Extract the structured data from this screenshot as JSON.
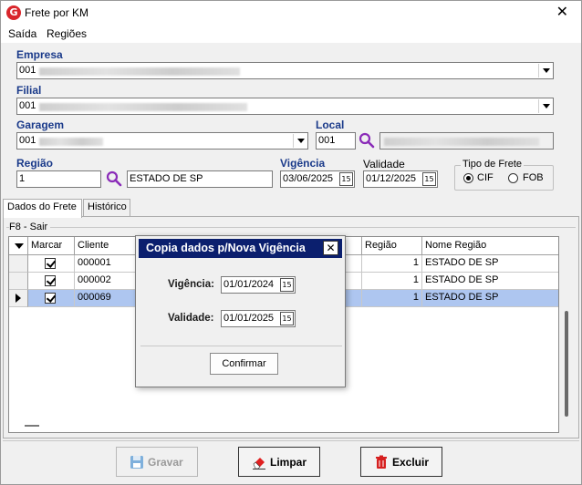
{
  "window": {
    "title": "Frete por KM",
    "close_glyph": "✕",
    "logo_glyph": "G"
  },
  "menu": {
    "items": [
      "Saída",
      "Regiões"
    ]
  },
  "form": {
    "empresa_label": "Empresa",
    "empresa_code": "001",
    "filial_label": "Filial",
    "filial_code": "001",
    "garagem_label": "Garagem",
    "garagem_code": "001",
    "local_label": "Local",
    "local_code": "001",
    "regiao_label": "Região",
    "regiao_code": "1",
    "regiao_name": "ESTADO DE SP",
    "vigencia_label": "Vigência",
    "vigencia_value": "03/06/2025",
    "validade_label": "Validade",
    "validade_value": "01/12/2025",
    "tipo_frete_label": "Tipo de Frete",
    "tipo_frete_options": [
      "CIF",
      "FOB"
    ],
    "tipo_frete_selected": "CIF",
    "date_btn_glyph": "15"
  },
  "tabs": [
    {
      "label": "Dados do Frete",
      "active": true
    },
    {
      "label": "Histórico",
      "active": false
    }
  ],
  "hint": "F8 - Sair",
  "grid": {
    "columns": [
      "Marcar",
      "Cliente",
      "Região",
      "Nome Região"
    ],
    "rows": [
      {
        "marcar": true,
        "cliente": "000001",
        "regiao": "1",
        "nome_regiao": "ESTADO DE SP",
        "selected": false
      },
      {
        "marcar": true,
        "cliente": "000002",
        "regiao": "1",
        "nome_regiao": "ESTADO DE SP",
        "selected": false
      },
      {
        "marcar": true,
        "cliente": "000069",
        "regiao": "1",
        "nome_regiao": "ESTADO DE SP",
        "selected": true
      }
    ]
  },
  "dialog": {
    "title": "Copia dados p/Nova Vigência",
    "close_glyph": "✕",
    "vigencia_label": "Vigência:",
    "vigencia_value": "01/01/2024",
    "validade_label": "Validade:",
    "validade_value": "01/01/2025",
    "confirm_label": "Confirmar"
  },
  "buttons": {
    "gravar": "Gravar",
    "limpar": "Limpar",
    "excluir": "Excluir"
  },
  "colors": {
    "label_blue": "#1a3a8a",
    "dialog_title_bg": "#0b1f6e",
    "selection": "#aec6f0",
    "search_purple": "#8a2bb8",
    "excluir_red": "#d62020"
  }
}
